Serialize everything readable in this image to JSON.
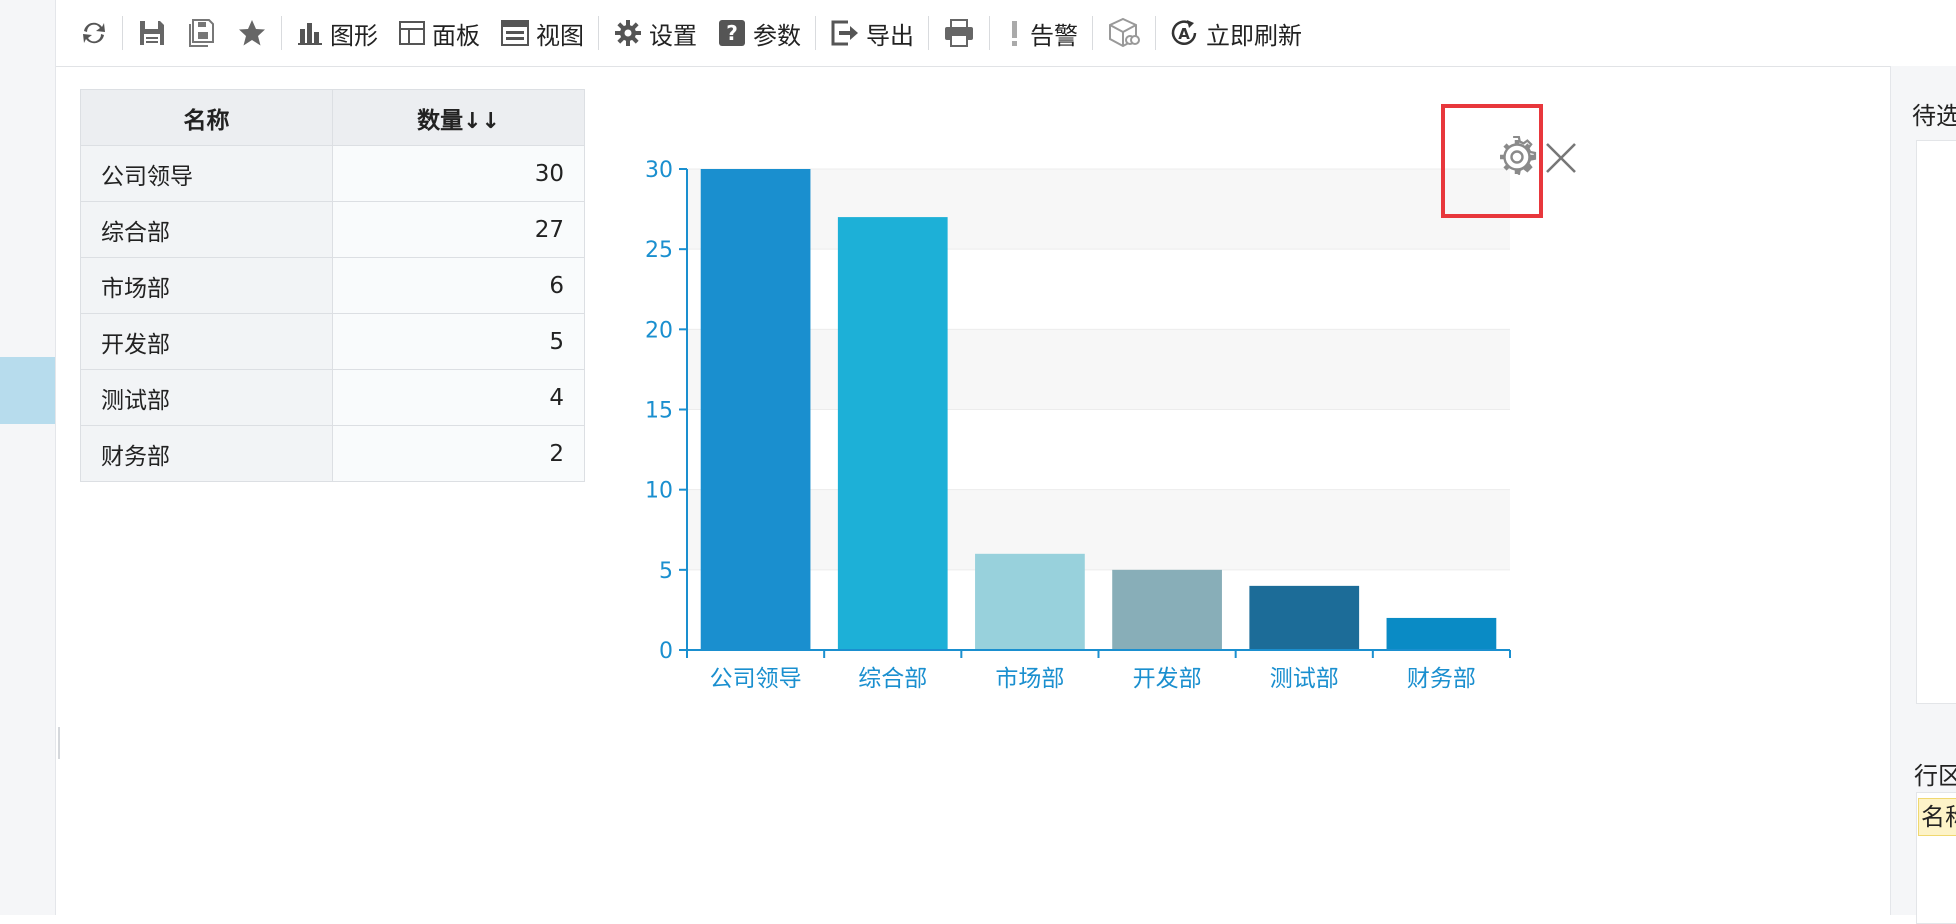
{
  "toolbar": {
    "items": [
      {
        "icon": "refresh-icon",
        "label": ""
      },
      {
        "icon": "save-icon",
        "label": ""
      },
      {
        "icon": "save-as-icon",
        "label": ""
      },
      {
        "icon": "star-icon",
        "label": ""
      },
      {
        "icon": "bar-chart-icon",
        "label": "图形"
      },
      {
        "icon": "panel-icon",
        "label": "面板"
      },
      {
        "icon": "view-icon",
        "label": "视图"
      },
      {
        "icon": "gear-icon",
        "label": "设置"
      },
      {
        "icon": "question-icon",
        "label": "参数"
      },
      {
        "icon": "export-icon",
        "label": "导出"
      },
      {
        "icon": "print-icon",
        "label": ""
      },
      {
        "icon": "exclamation-icon",
        "label": "告警"
      },
      {
        "icon": "cube-link-icon",
        "label": ""
      },
      {
        "icon": "auto-refresh-icon",
        "label": "立即刷新"
      }
    ]
  },
  "grid": {
    "headers": {
      "name": "名称",
      "count": "数量",
      "sort_glyph": "↓↓"
    },
    "rows": [
      {
        "name": "公司领导",
        "count": "30"
      },
      {
        "name": "综合部",
        "count": "27"
      },
      {
        "name": "市场部",
        "count": "6"
      },
      {
        "name": "开发部",
        "count": "5"
      },
      {
        "name": "测试部",
        "count": "4"
      },
      {
        "name": "财务部",
        "count": "2"
      }
    ]
  },
  "chart_data": {
    "type": "bar",
    "categories": [
      "公司领导",
      "综合部",
      "市场部",
      "开发部",
      "测试部",
      "财务部"
    ],
    "values": [
      30,
      27,
      6,
      5,
      4,
      2
    ],
    "bar_colors": [
      "#1a8fcf",
      "#1db0d7",
      "#98d1dc",
      "#88aeb8",
      "#1c6c98",
      "#0a8bc5"
    ],
    "axis_color": "#1a8fcf",
    "yticks": [
      0,
      5,
      10,
      15,
      20,
      25,
      30
    ],
    "ylim": [
      0,
      30
    ],
    "grid": true,
    "title": "",
    "xlabel": "",
    "ylabel": ""
  },
  "chart_controls": {
    "settings_icon": "gear-icon",
    "close_icon": "close-icon",
    "highlight_color": "#e8373c"
  },
  "right_panel": {
    "title_top": "待选",
    "title_bottom": "行区",
    "field_chip": "名称"
  }
}
